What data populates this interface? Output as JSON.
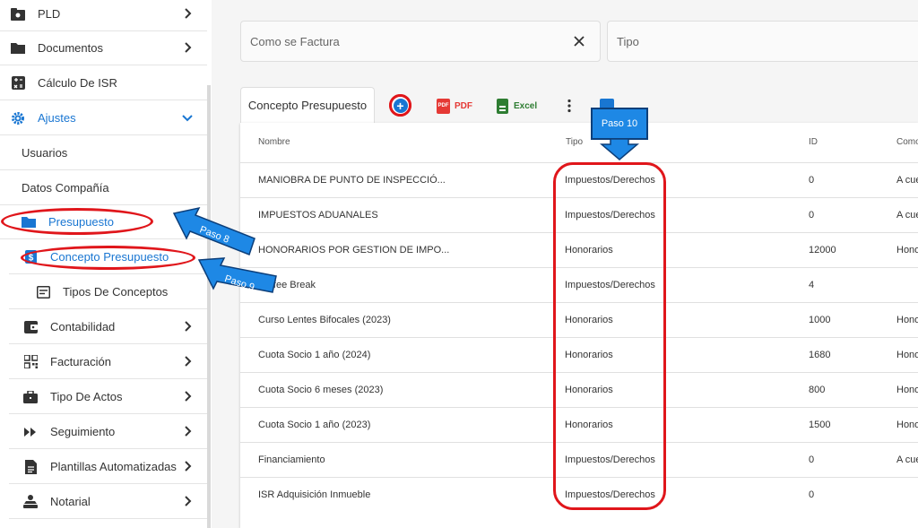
{
  "sidebar": {
    "pld": "PLD",
    "documentos": "Documentos",
    "calculo_isr": "Cálculo De ISR",
    "ajustes": "Ajustes",
    "usuarios": "Usuarios",
    "datos_compania": "Datos Compañía",
    "presupuesto": "Presupuesto",
    "concepto_presupuesto": "Concepto Presupuesto",
    "tipos_de_conceptos": "Tipos De Conceptos",
    "contabilidad": "Contabilidad",
    "facturacion": "Facturación",
    "tipo_de_actos": "Tipo De Actos",
    "seguimiento": "Seguimiento",
    "plantillas": "Plantillas Automatizadas",
    "notarial": "Notarial"
  },
  "filters": {
    "como_se_factura": "Como se Factura",
    "tipo": "Tipo"
  },
  "toolbar": {
    "tab": "Concepto Presupuesto",
    "pdf": "PDF",
    "pdf_icon_text": "PDF",
    "excel": "Excel"
  },
  "table": {
    "headers": {
      "nombre": "Nombre",
      "tipo": "Tipo",
      "id": "ID",
      "como": "Como"
    },
    "rows": [
      {
        "nombre": "MANIOBRA DE PUNTO DE INSPECCIÓ...",
        "tipo": "Impuestos/Derechos",
        "id": "0",
        "como": "A cue"
      },
      {
        "nombre": "IMPUESTOS ADUANALES",
        "tipo": "Impuestos/Derechos",
        "id": "0",
        "como": "A cue"
      },
      {
        "nombre": "HONORARIOS POR GESTION DE IMPO...",
        "tipo": "Honorarios",
        "id": "12000",
        "como": "Hono"
      },
      {
        "nombre": "Coffee Break",
        "tipo": "Impuestos/Derechos",
        "id": "4",
        "como": ""
      },
      {
        "nombre": "Curso Lentes Bifocales (2023)",
        "tipo": "Honorarios",
        "id": "1000",
        "como": "Hono"
      },
      {
        "nombre": "Cuota Socio 1 año (2024)",
        "tipo": "Honorarios",
        "id": "1680",
        "como": "Hono"
      },
      {
        "nombre": "Cuota Socio 6 meses (2023)",
        "tipo": "Honorarios",
        "id": "800",
        "como": "Hono"
      },
      {
        "nombre": "Cuota Socio 1 año (2023)",
        "tipo": "Honorarios",
        "id": "1500",
        "como": "Hono"
      },
      {
        "nombre": "Financiamiento",
        "tipo": "Impuestos/Derechos",
        "id": "0",
        "como": "A cue"
      },
      {
        "nombre": "ISR Adquisición Inmueble",
        "tipo": "Impuestos/Derechos",
        "id": "0",
        "como": ""
      }
    ]
  },
  "callouts": {
    "paso8": "Paso 8",
    "paso9": "Paso 9",
    "paso10": "Paso 10"
  },
  "colors": {
    "accent": "#1976d2",
    "annotation_red": "#e0161b",
    "callout_blue": "#1e88e5",
    "pdf_red": "#e53935",
    "excel_green": "#2e7d32"
  }
}
